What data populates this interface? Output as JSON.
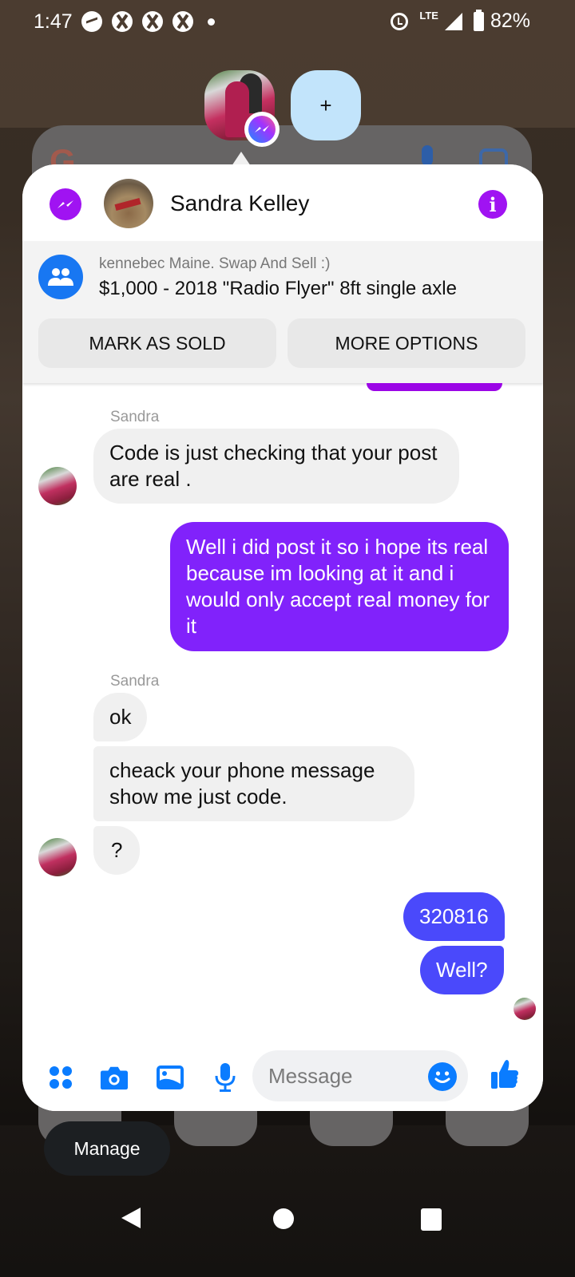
{
  "status_bar": {
    "time": "1:47",
    "notification_icons": [
      "messenger-icon",
      "xbox-icon",
      "xbox-icon",
      "xbox-icon",
      "more-dot-icon"
    ],
    "network": "LTE",
    "battery": "82%",
    "right_icons": [
      "alarm-icon",
      "lte-label",
      "signal-icon",
      "battery-icon"
    ]
  },
  "bubbles": {
    "add_label": "+"
  },
  "chat": {
    "contact_name": "Sandra Kelley",
    "listing": {
      "group": "kennebec Maine. Swap And Sell :)",
      "title": "$1,000 - 2018 \"Radio Flyer\" 8ft single axle",
      "mark_sold": "MARK AS SOLD",
      "more_options": "MORE OPTIONS"
    },
    "messages": [
      {
        "sender": "Sandra",
        "direction": "in",
        "text": "Code is just checking that your post are real ."
      },
      {
        "sender": "me",
        "direction": "out",
        "text": "Well i did post it so i hope its real because im looking at it and i would only accept real money for it"
      },
      {
        "sender": "Sandra",
        "direction": "in",
        "text": "ok"
      },
      {
        "sender": "Sandra",
        "direction": "in",
        "text": "cheack your phone message show me just code."
      },
      {
        "sender": "Sandra",
        "direction": "in",
        "text": "?"
      },
      {
        "sender": "me",
        "direction": "out",
        "text": "320816"
      },
      {
        "sender": "me",
        "direction": "out",
        "text": "Well?"
      }
    ],
    "sender_label_1": "Sandra",
    "sender_label_2": "Sandra",
    "composer": {
      "placeholder": "Message"
    }
  },
  "manage_label": "Manage",
  "colors": {
    "messenger_purple": "#a013f2",
    "outgoing_purple": "#8122fb",
    "outgoing_blue": "#4a49fb",
    "accent_blue": "#0a7cff",
    "incoming_gray": "#f0f0f0"
  }
}
